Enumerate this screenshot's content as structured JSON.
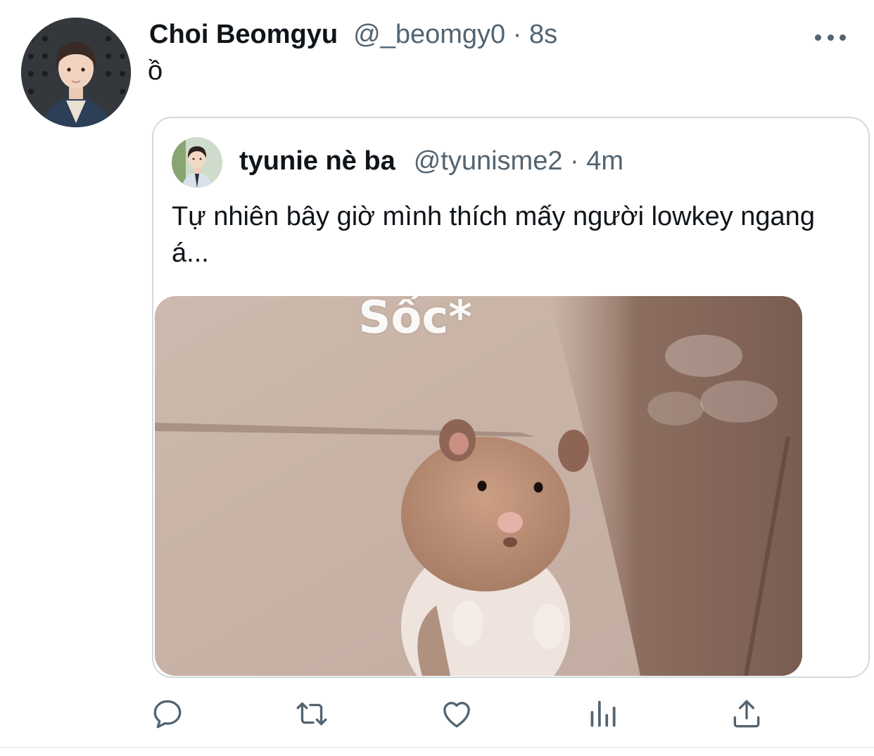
{
  "tweet": {
    "author": {
      "display_name": "Choi Beomgyu",
      "handle": "@_beomgy0",
      "time": "8s",
      "avatar_icon": "profile-photo"
    },
    "text": "ồ",
    "more_icon": "more-horizontal-icon"
  },
  "quoted_tweet": {
    "author": {
      "display_name": "tyunie nè ba",
      "handle": "@tyunisme2",
      "time": "4m",
      "avatar_icon": "profile-photo"
    },
    "text": "Tự nhiên bây giờ mình thích mấy người lowkey ngang á...",
    "media": {
      "caption": "Sốc*",
      "description_icon": "hamster-photo"
    }
  },
  "actions": [
    {
      "name": "reply",
      "icon": "reply-icon"
    },
    {
      "name": "retweet",
      "icon": "retweet-icon"
    },
    {
      "name": "like",
      "icon": "heart-icon"
    },
    {
      "name": "views",
      "icon": "analytics-icon"
    },
    {
      "name": "share",
      "icon": "share-icon"
    }
  ],
  "colors": {
    "text_primary": "#0f1419",
    "text_secondary": "#536471",
    "border": "#cfd9de"
  }
}
